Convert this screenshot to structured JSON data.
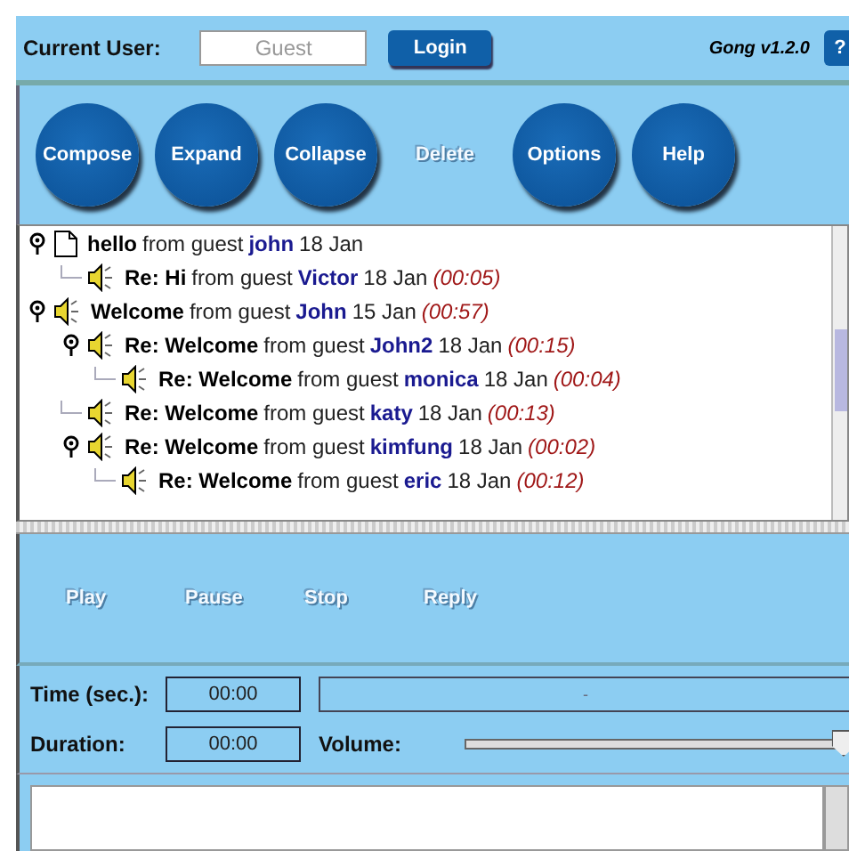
{
  "header": {
    "user_label": "Current User:",
    "user_placeholder": "Guest",
    "login_button": "Login",
    "version": "Gong v1.2.0",
    "help_button": "?"
  },
  "toolbar": [
    {
      "label": "Compose",
      "disabled": false
    },
    {
      "label": "Expand",
      "disabled": false
    },
    {
      "label": "Collapse",
      "disabled": false
    },
    {
      "label": "Delete",
      "disabled": true
    },
    {
      "label": "Options",
      "disabled": false
    },
    {
      "label": "Help",
      "disabled": false
    }
  ],
  "messages": [
    {
      "kind": "text",
      "subject": "hello",
      "from": "from guest",
      "user": "john",
      "date": "18 Jan",
      "children": [
        {
          "kind": "audio",
          "subject": "Re: Hi",
          "from": "from guest",
          "user": "Victor",
          "date": "18 Jan",
          "duration": "(00:05)"
        }
      ]
    },
    {
      "kind": "audio",
      "subject": "Welcome",
      "from": "from guest",
      "user": "John",
      "date": "15 Jan",
      "duration": "(00:57)",
      "children": [
        {
          "kind": "audio",
          "subject": "Re: Welcome",
          "from": "from guest",
          "user": "John2",
          "date": "18 Jan",
          "duration": "(00:15)",
          "children": [
            {
              "kind": "audio",
              "subject": "Re: Welcome",
              "from": "from guest",
              "user": "monica",
              "date": "18 Jan",
              "duration": "(00:04)"
            }
          ]
        },
        {
          "kind": "audio",
          "subject": "Re: Welcome",
          "from": "from guest",
          "user": "katy",
          "date": "18 Jan",
          "duration": "(00:13)"
        },
        {
          "kind": "audio",
          "subject": "Re: Welcome",
          "from": "from guest",
          "user": "kimfung",
          "date": "18 Jan",
          "duration": "(00:02)",
          "children": [
            {
              "kind": "audio",
              "subject": "Re: Welcome",
              "from": "from guest",
              "user": "eric",
              "date": "18 Jan",
              "duration": "(00:12)"
            }
          ]
        }
      ]
    }
  ],
  "player": [
    {
      "label": "Play",
      "disabled": true
    },
    {
      "label": "Pause",
      "disabled": true
    },
    {
      "label": "Stop",
      "disabled": true
    },
    {
      "label": "Reply",
      "disabled": true
    }
  ],
  "time": {
    "label": "Time (sec.):",
    "value": "00:00",
    "progress_text": "-"
  },
  "duration": {
    "label": "Duration:",
    "value": "00:00"
  },
  "volume": {
    "label": "Volume:",
    "level": 0.97
  }
}
